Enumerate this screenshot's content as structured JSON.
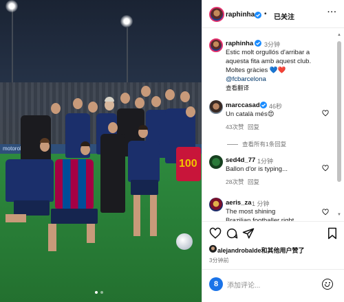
{
  "post": {
    "author": "raphinha",
    "follow_status": "已关注",
    "caption_time": "3分钟",
    "caption": "Estic molt orgullós d'arribar a aquesta fita amb aquest club. Moltes gràcies 💙❤️",
    "caption_tag": "@fcbarcelona",
    "translate_label": "查看翻译",
    "image_alt_texts": {
      "board_text": "motorola",
      "shirt_number": "100"
    },
    "carousel_pages": 2,
    "carousel_active": 1
  },
  "comments": [
    {
      "user": "marccasado",
      "verified": true,
      "time": "46秒",
      "text": "Un català més😍",
      "likes": "43次赞",
      "reply": "回复",
      "view_replies": "查看所有1条回复"
    },
    {
      "user": "sed4d_77",
      "verified": false,
      "time": "1分钟",
      "text": "Ballon d'or is typing...",
      "likes": "28次赞",
      "reply": "回复"
    },
    {
      "user": "aeris_za",
      "verified": false,
      "time": "1 分钟",
      "text": "The most shining Brazilian footballer right now🔥🙏"
    }
  ],
  "actions": {
    "like_icon": "heart-icon",
    "comment_icon": "comment-icon",
    "share_icon": "share-icon",
    "save_icon": "bookmark-icon"
  },
  "likes_summary": {
    "user": "alejandrobalde",
    "rest": "和其他用户赞了"
  },
  "posted_ago": "3分钟前",
  "composer": {
    "avatar_letter": "8",
    "placeholder": "添加评论..."
  },
  "colors": {
    "verified_blue": "#1a8cff",
    "link": "#00376b",
    "muted": "#737373",
    "barca_blue": "#004d98",
    "barca_red": "#a50044"
  }
}
